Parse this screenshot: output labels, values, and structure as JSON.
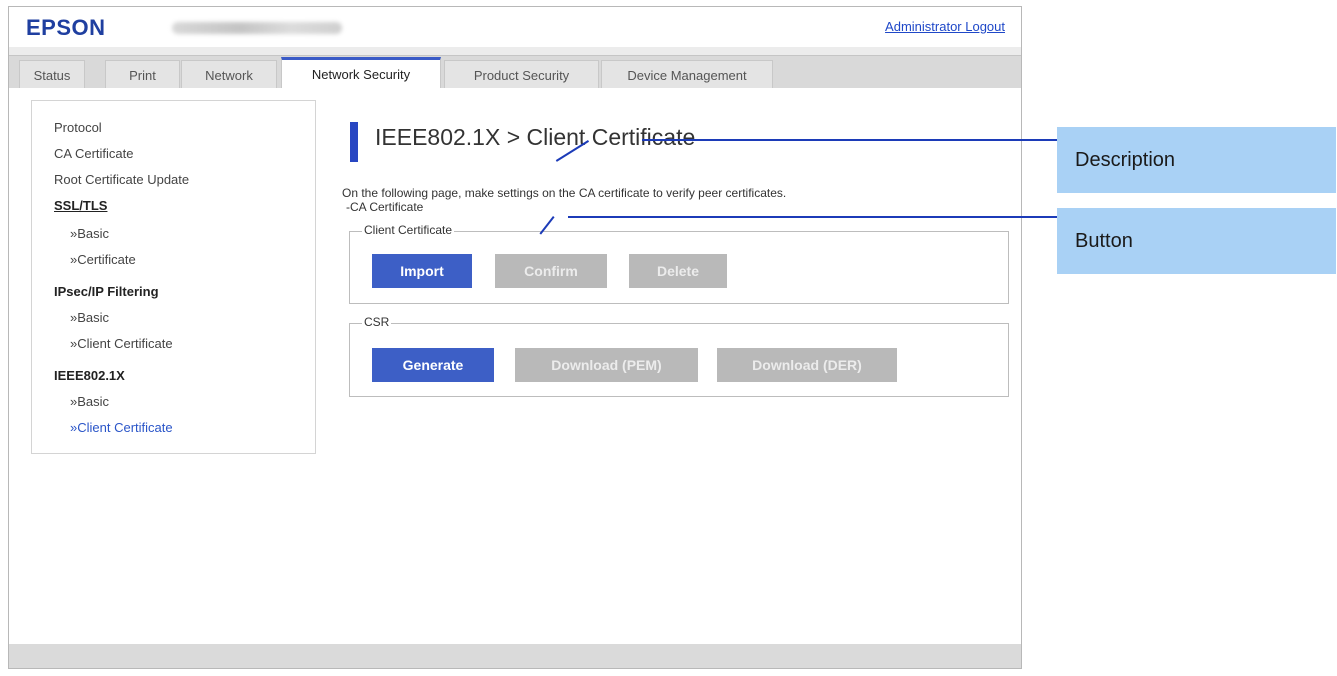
{
  "header": {
    "logo": "EPSON",
    "logout": "Administrator Logout"
  },
  "tabs": [
    {
      "label": "Status",
      "active": false
    },
    {
      "label": "Print",
      "active": false
    },
    {
      "label": "Network",
      "active": false
    },
    {
      "label": "Network Security",
      "active": true
    },
    {
      "label": "Product Security",
      "active": false
    },
    {
      "label": "Device Management",
      "active": false
    }
  ],
  "sidebar": {
    "items": [
      {
        "label": "Protocol"
      },
      {
        "label": "CA Certificate"
      },
      {
        "label": "Root Certificate Update"
      },
      {
        "label": "SSL/TLS"
      },
      {
        "label": "»Basic"
      },
      {
        "label": "»Certificate"
      },
      {
        "label": "IPsec/IP Filtering"
      },
      {
        "label": "»Basic"
      },
      {
        "label": "»Client Certificate"
      },
      {
        "label": "IEEE802.1X"
      },
      {
        "label": "»Basic"
      },
      {
        "label": "»Client Certificate",
        "selected": true
      }
    ]
  },
  "main": {
    "title": "IEEE802.1X > Client Certificate",
    "description_line1": "On the following page, make settings on the CA certificate to verify peer certificates.",
    "description_line2": "-CA Certificate",
    "client_certificate": {
      "legend": "Client Certificate",
      "import": "Import",
      "confirm": "Confirm",
      "delete": "Delete"
    },
    "csr": {
      "legend": "CSR",
      "generate": "Generate",
      "download_pem": "Download (PEM)",
      "download_der": "Download (DER)"
    }
  },
  "callouts": {
    "description": "Description",
    "button": "Button"
  },
  "colors": {
    "accent": "#3d5fc6",
    "link": "#1f48c8",
    "callout": "#a9d1f5"
  }
}
